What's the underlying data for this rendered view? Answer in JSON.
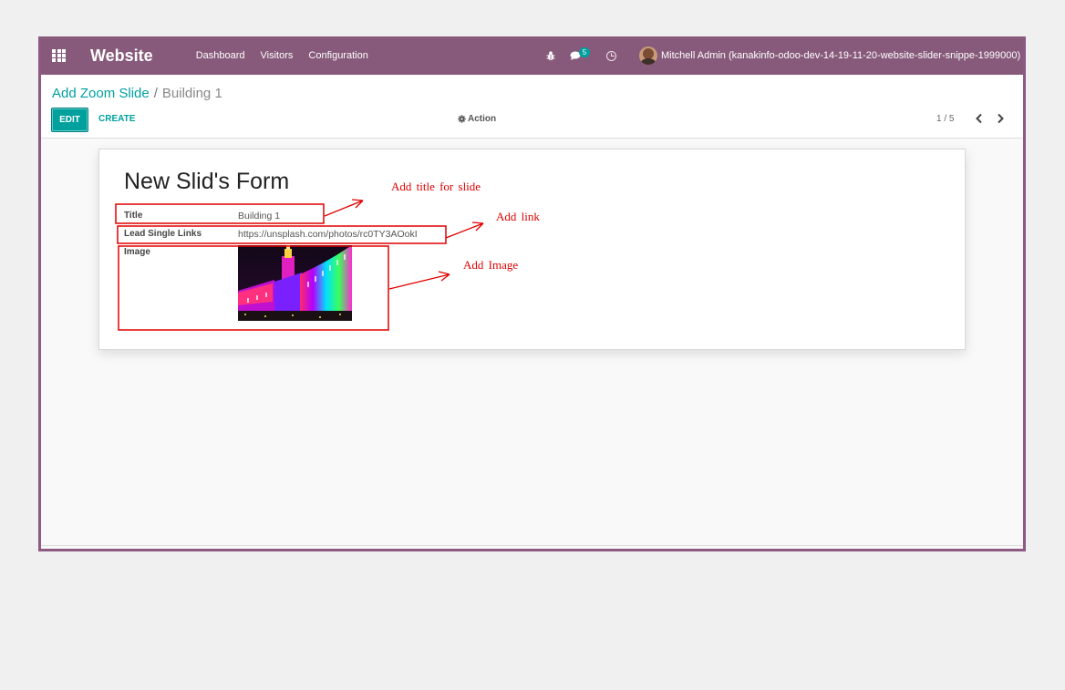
{
  "navbar": {
    "app_name": "Website",
    "menu": [
      "Dashboard",
      "Visitors",
      "Configuration"
    ],
    "message_count": "5",
    "user_name": "Mitchell Admin (kanakinfo-odoo-dev-14-19-11-20-website-slider-snippe-1999000)",
    "color": "#875a7b"
  },
  "breadcrumb": {
    "parent": "Add Zoom Slide",
    "separator": "/",
    "current": "Building 1"
  },
  "toolbar": {
    "edit_label": "EDIT",
    "create_label": "CREATE",
    "action_label": "Action",
    "pager_value": "1 / 5",
    "accent": "#00a09d"
  },
  "form": {
    "title": "New Slid's Form",
    "fields": [
      {
        "label": "Title",
        "value": "Building 1"
      },
      {
        "label": "Lead Single Links",
        "value": "https://unsplash.com/photos/rc0TY3AOokI"
      },
      {
        "label": "Image",
        "value": ""
      }
    ]
  },
  "annotations": {
    "title_note": "Add title for slide",
    "link_note": "Add link",
    "image_note": "Add Image",
    "color": "#e00000"
  },
  "icons": [
    "apps-grid-icon",
    "bug-icon",
    "chat-icon",
    "clock-icon",
    "gear-icon",
    "chevron-left-icon",
    "chevron-right-icon"
  ]
}
